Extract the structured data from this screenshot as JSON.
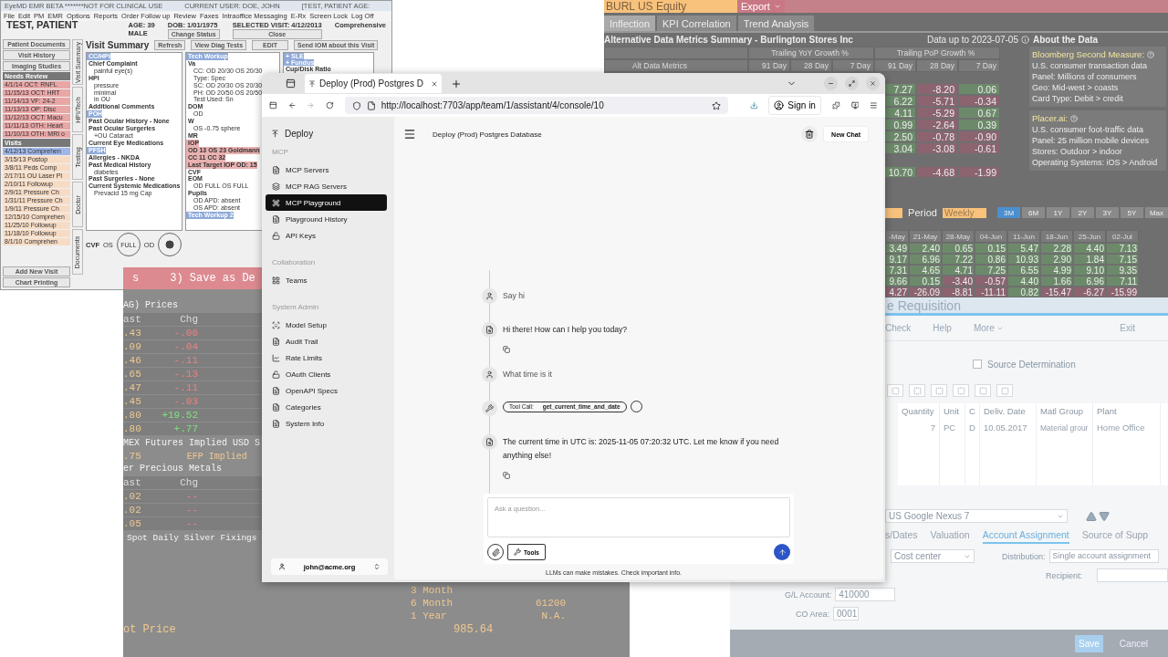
{
  "emr": {
    "title": "EyeMD EMR BETA *******NOT FOR CLINICAL USE",
    "user": "CURRENT USER: DOE, JOHN",
    "patient_tag": "[TEST, PATIENT AGE:",
    "menu": [
      "File",
      "Edit",
      "PM",
      "EMR",
      "Options",
      "Reports",
      "Order Follow up",
      "Review",
      "Faxes",
      "Intraoffice Messaging",
      "E-Rx",
      "Screen Lock",
      "Log Off"
    ],
    "patient": "TEST, PATIENT",
    "age": "AGE: 39",
    "sex": "MALE",
    "dob": "DOB: 1/01/1975",
    "visit": "SELECTED VISIT: 4/12/2013",
    "visit_type": "Comprehensive",
    "change_status": "Change Status",
    "close": "Close",
    "nav_buttons": [
      "Patient Documents",
      "Visit History",
      "Imaging Studies"
    ],
    "needs_review_title": "Needs Review",
    "needs_review": [
      "4/1/14 OCT: RNFL",
      "11/15/13 OCT: HRT",
      "11/14/13 VF: 24-2",
      "11/13/13 OP: Disc",
      "11/12/13 OCT: Macu",
      "11/11/13 OTH: Heart",
      "11/10/13 OTH: MRI o"
    ],
    "visits_title": "Visits",
    "visits": [
      {
        "text": "4/12/13 Comprehen",
        "selected": true
      },
      {
        "text": "3/15/13 Postop",
        "selected": false
      },
      {
        "text": "3/8/11 Peds Comp",
        "selected": false
      },
      {
        "text": "2/17/11 OU Laser PI",
        "selected": false
      },
      {
        "text": "2/10/11 Followup",
        "selected": false
      },
      {
        "text": "2/9/11 Pressure Ch",
        "selected": false
      },
      {
        "text": "1/31/11 Pressure Ch",
        "selected": false
      },
      {
        "text": "1/9/11 Pressure Ch",
        "selected": false
      },
      {
        "text": "12/15/10 Comprehen",
        "selected": false
      },
      {
        "text": "11/25/10 Followup",
        "selected": false
      },
      {
        "text": "11/18/10 Followup",
        "selected": false
      },
      {
        "text": "8/1/10 Comprehen",
        "selected": false
      }
    ],
    "side_tabs": [
      "Visit Summary",
      "HPI/Tech",
      "Testing",
      "Doctor",
      "Documents"
    ],
    "summary_title": "Visit Summary",
    "refresh": "Refresh",
    "view_diag": "View Diag Tests",
    "edit": "EDIT",
    "send_iom": "Send IOM about this Visit",
    "panels": [
      [
        {
          "text": "CC/HPI",
          "kind": "header"
        },
        {
          "text": "Chief Complaint",
          "kind": "bold"
        },
        {
          "text": "painful eye(s)",
          "kind": "plain"
        },
        {
          "text": "HPI",
          "kind": "bold"
        },
        {
          "text": "pressure",
          "kind": "plain"
        },
        {
          "text": "minimal",
          "kind": "plain"
        },
        {
          "text": "in OU",
          "kind": "plain"
        },
        {
          "text": "Additional Comments",
          "kind": "bold"
        },
        {
          "text": "POH",
          "kind": "header"
        },
        {
          "text": "Past Ocular History - None",
          "kind": "bold"
        },
        {
          "text": "Past Ocular Surgeries",
          "kind": "bold"
        },
        {
          "text": "+OU Cataract",
          "kind": "plain"
        },
        {
          "text": "Current Eye Medications",
          "kind": "bold"
        },
        {
          "text": "PFSH",
          "kind": "header"
        },
        {
          "text": "Allergies - NKDA",
          "kind": "bold"
        },
        {
          "text": "Past Medical History",
          "kind": "bold"
        },
        {
          "text": "diabetes",
          "kind": "plain"
        },
        {
          "text": "Past Surgeries - None",
          "kind": "bold"
        },
        {
          "text": "Current Systemic Medications",
          "kind": "bold"
        },
        {
          "text": "Prevacid 15 mg Cap",
          "kind": "plain"
        }
      ],
      [
        {
          "text": "Tech Workup",
          "kind": "header"
        },
        {
          "text": "Va",
          "kind": "bold"
        },
        {
          "text": "CC: OD 20/30 OS 20/30",
          "kind": "plain"
        },
        {
          "text": "Type: Spec",
          "kind": "plain"
        },
        {
          "text": "SC: OD 20/30 OS 20/30",
          "kind": "plain"
        },
        {
          "text": "PH: OD 20/50 OS 20/50",
          "kind": "plain"
        },
        {
          "text": "Test Used: Sn",
          "kind": "plain"
        },
        {
          "text": "DOM",
          "kind": "bold"
        },
        {
          "text": "OD",
          "kind": "plain"
        },
        {
          "text": "W",
          "kind": "bold"
        },
        {
          "text": "OS -0.75 sphere",
          "kind": "plain"
        },
        {
          "text": "MR",
          "kind": "bold"
        },
        {
          "text": "IOP",
          "kind": "alert"
        },
        {
          "text": "OD 13 OS 23 Goldmann",
          "kind": "alert"
        },
        {
          "text": "CC 11 CC 32",
          "kind": "alert"
        },
        {
          "text": "Last Target IOP OD: 15",
          "kind": "alert"
        },
        {
          "text": "CVF",
          "kind": "bold"
        },
        {
          "text": "EOM",
          "kind": "bold"
        },
        {
          "text": "OD FULL OS FULL",
          "kind": "plain"
        },
        {
          "text": "Pupils",
          "kind": "bold"
        },
        {
          "text": "OD APD: absent",
          "kind": "plain"
        },
        {
          "text": "OS APD: absent",
          "kind": "plain"
        },
        {
          "text": "Tech Workup 2",
          "kind": "header"
        }
      ],
      [
        {
          "text": "+ SLE",
          "kind": "header"
        },
        {
          "text": "+ Fundus",
          "kind": "header"
        },
        {
          "text": "Cup/Disk Ratio",
          "kind": "bold"
        }
      ]
    ],
    "cvf": "CVF",
    "os": "OS",
    "od": "OD",
    "full": "FULL",
    "add_visit": "Add New Visit",
    "chart_printing": "Chart Printing"
  },
  "bloomberg": {
    "ticker": "BURL US Equity",
    "export": "Export",
    "tabs": [
      {
        "label": "Inflection",
        "selected": true
      },
      {
        "label": "KPI Correlation",
        "selected": false
      },
      {
        "label": "Trend Analysis",
        "selected": false
      }
    ],
    "title": "Alternative Data Metrics Summary - Burlington Stores Inc",
    "data_up_to": "Data up to 2023-07-05",
    "about": "About the Data",
    "yoy_header": "Trailing YoY Growth %",
    "pop_header": "Trailing PoP Growth %",
    "metrics_header": "Alt Data Metrics",
    "yoy_days": [
      "91 Day",
      "28 Day",
      "7 Day"
    ],
    "pop_days": [
      "91 Day",
      "28 Day",
      "7 Day"
    ],
    "rows": [
      [
        {
          "value": "7.27",
          "negative": false
        },
        {
          "value": "-8.20",
          "negative": true
        },
        {
          "value": "0.06",
          "negative": false
        }
      ],
      [
        {
          "value": "6.22",
          "negative": false
        },
        {
          "value": "-5.71",
          "negative": true
        },
        {
          "value": "-0.34",
          "negative": true
        }
      ],
      [
        {
          "value": "4.11",
          "negative": false
        },
        {
          "value": "-5.29",
          "negative": true
        },
        {
          "value": "0.67",
          "negative": false
        }
      ],
      [
        {
          "value": "0.99",
          "negative": false
        },
        {
          "value": "-2.64",
          "negative": true
        },
        {
          "value": "0.39",
          "negative": false
        }
      ],
      [
        {
          "value": "2.50",
          "negative": false
        },
        {
          "value": "-0.78",
          "negative": true
        },
        {
          "value": "-0.90",
          "negative": true
        }
      ],
      [
        {
          "value": "3.04",
          "negative": false
        },
        {
          "value": "-3.08",
          "negative": true
        },
        {
          "value": "-0.61",
          "negative": true
        }
      ],
      [],
      [
        {
          "value": "10.70",
          "negative": false
        },
        {
          "value": "-4.68",
          "negative": true
        },
        {
          "value": "-1.99",
          "negative": true
        }
      ]
    ],
    "sources": [
      {
        "name": "Bloomberg Second Measure:",
        "lines": [
          "U.S. consumer transaction data",
          "Panel: Millions of consumers",
          "Geo: Mid-west > coasts",
          "Card Type: Debit > credit"
        ]
      },
      {
        "name": "Placer.ai:",
        "lines": [
          "U.S. consumer foot-traffic data",
          "Panel: 25 million mobile devices",
          "Stores: Outdoor > indoor",
          "Operating Systems: iOS > Android"
        ]
      }
    ],
    "period_label": "Period",
    "period": "Weekly",
    "ranges": [
      {
        "label": "3M",
        "selected": true
      },
      {
        "label": "6M",
        "selected": false
      },
      {
        "label": "1Y",
        "selected": false
      },
      {
        "label": "2Y",
        "selected": false
      },
      {
        "label": "3Y",
        "selected": false
      },
      {
        "label": "5Y",
        "selected": false
      },
      {
        "label": "Max",
        "selected": false
      }
    ],
    "weeks": [
      "-May",
      "21-May",
      "28-May",
      "04-Jun",
      "11-Jun",
      "18-Jun",
      "25-Jun",
      "02-Jul"
    ],
    "weekly_rows": [
      [
        {
          "value": "3.49",
          "negative": false
        },
        {
          "value": "2.40",
          "negative": false
        },
        {
          "value": "0.65",
          "negative": false
        },
        {
          "value": "0.15",
          "negative": false
        },
        {
          "value": "5.47",
          "negative": false
        },
        {
          "value": "2.28",
          "negative": false
        },
        {
          "value": "4.40",
          "negative": false
        },
        {
          "value": "7.13",
          "negative": false
        }
      ],
      [
        {
          "value": "9.17",
          "negative": false
        },
        {
          "value": "6.96",
          "negative": false
        },
        {
          "value": "7.22",
          "negative": false
        },
        {
          "value": "0.86",
          "negative": false
        },
        {
          "value": "10.93",
          "negative": false
        },
        {
          "value": "2.90",
          "negative": false
        },
        {
          "value": "1.84",
          "negative": false
        },
        {
          "value": "7.15",
          "negative": false
        }
      ],
      [
        {
          "value": "7.31",
          "negative": false
        },
        {
          "value": "4.65",
          "negative": false
        },
        {
          "value": "4.71",
          "negative": false
        },
        {
          "value": "7.25",
          "negative": false
        },
        {
          "value": "6.55",
          "negative": false
        },
        {
          "value": "4.99",
          "negative": false
        },
        {
          "value": "9.10",
          "negative": false
        },
        {
          "value": "9.35",
          "negative": false
        }
      ],
      [
        {
          "value": "9.66",
          "negative": false
        },
        {
          "value": "0.15",
          "negative": false
        },
        {
          "value": "-3.40",
          "negative": true
        },
        {
          "value": "-0.57",
          "negative": true
        },
        {
          "value": "4.40",
          "negative": false
        },
        {
          "value": "1.66",
          "negative": false
        },
        {
          "value": "6.96",
          "negative": false
        },
        {
          "value": "7.11",
          "negative": false
        }
      ],
      [
        {
          "value": "4.27",
          "negative": true
        },
        {
          "value": "-26.09",
          "negative": true
        },
        {
          "value": "-8.81",
          "negative": true
        },
        {
          "value": "-11.11",
          "negative": true
        },
        {
          "value": "0.82",
          "negative": false
        },
        {
          "value": "-15.47",
          "negative": true
        },
        {
          "value": "-6.27",
          "negative": true
        },
        {
          "value": "-15.99",
          "negative": true
        }
      ]
    ]
  },
  "sap": {
    "title": "e Requisition",
    "toolbar": [
      "Check",
      "Help",
      "More"
    ],
    "exit": "Exit",
    "source_determination": {
      "label": "Source Determination",
      "checked": false
    },
    "columns": [
      "Quantity",
      "Unit",
      "C",
      "Deliv. Date",
      "Matl Group",
      "Plant"
    ],
    "row": [
      "7",
      "PC",
      "D",
      "10.05.2017",
      "Material grour",
      "Home Office"
    ],
    "item": "US Google Nexus 7",
    "tabs": [
      {
        "label": "s/Dates",
        "selected": false
      },
      {
        "label": "Valuation",
        "selected": false
      },
      {
        "label": "Account Assignment",
        "selected": true
      },
      {
        "label": "Source of Supp",
        "selected": false
      }
    ],
    "category": "Cost center",
    "distribution_label": "Distribution:",
    "distribution": "Single account assignment",
    "recipient_label": "Recipient:",
    "gl_label": "G/L Account:",
    "gl": "410000",
    "co_label": "CO Area:",
    "co": "0001",
    "save": "Save",
    "cancel": "Cancel"
  },
  "metals": {
    "banner_left": "s",
    "banner": "3) Save as De",
    "prices_title": "AG) Prices",
    "headers": [
      "ast",
      "Chg"
    ],
    "prices": [
      {
        "last": ".43",
        "chg": "-.06"
      },
      {
        "last": ".09",
        "chg": "-.04"
      },
      {
        "last": ".46",
        "chg": "-.11"
      },
      {
        "last": ".65",
        "chg": "-.13"
      },
      {
        "last": ".47",
        "chg": "-.11"
      },
      {
        "last": ".45",
        "chg": "-.03"
      },
      {
        "last": ".80",
        "chg": "+19.52"
      },
      {
        "last": ".80",
        "chg": "+.77"
      }
    ],
    "futures": "MEX Futures Implied USD S",
    "efp_value": ".75",
    "efp": "EFP Implied",
    "precious": "er Precious Metals",
    "headers2": [
      "ast",
      "Chg"
    ],
    "precious_rows": [
      {
        "last": ".02",
        "chg": "--"
      },
      {
        "last": ".02",
        "chg": "--"
      },
      {
        "last": ".05",
        "chg": "--"
      }
    ],
    "fixings": "Spot Daily Silver Fixings",
    "terms": [
      {
        "label": "3 Month"
      },
      {
        "label": "6 Month",
        "value": "61200"
      },
      {
        "label": "1 Year",
        "value": "N.A."
      }
    ],
    "spot_label": "ot Price",
    "spot": "985.64"
  },
  "browser": {
    "tab_title": "Deploy (Prod) Postgres D",
    "url": "http://localhost:7703/app/team/1/assistant/4/console/10",
    "sign_in": "Sign in",
    "app": {
      "brand": "Deploy",
      "sections": [
        {
          "title": "MCP",
          "items": [
            {
              "label": "MCP Servers",
              "kind": "doc",
              "selected": false
            },
            {
              "label": "MCP RAG Servers",
              "kind": "layers",
              "selected": false
            },
            {
              "label": "MCP Playground",
              "kind": "command",
              "selected": true
            },
            {
              "label": "Playground History",
              "kind": "doc",
              "selected": false
            },
            {
              "label": "API Keys",
              "kind": "lock",
              "selected": false
            }
          ]
        },
        {
          "title": "Collaboration",
          "items": [
            {
              "label": "Teams",
              "kind": "grid",
              "selected": false
            }
          ]
        },
        {
          "title": "System Admin",
          "items": [
            {
              "label": "Model Setup",
              "kind": "scan",
              "selected": false
            },
            {
              "label": "Audit Trail",
              "kind": "doc",
              "selected": false
            },
            {
              "label": "Rate Limits",
              "kind": "chart",
              "selected": false
            },
            {
              "label": "OAuth Clients",
              "kind": "lock",
              "selected": false
            },
            {
              "label": "OpenAPI Specs",
              "kind": "doc",
              "selected": false
            },
            {
              "label": "Categories",
              "kind": "doc",
              "selected": false
            },
            {
              "label": "System Info",
              "kind": "doc",
              "selected": false
            }
          ]
        }
      ],
      "user": "john@acme.org",
      "chat_title": "Deploy (Prod) Postgres Database",
      "new_chat": "New Chat",
      "messages": [
        {
          "kind": "user",
          "text": "Say hi"
        },
        {
          "kind": "assistant",
          "text": "Hi there! How can I help you today?"
        },
        {
          "kind": "user",
          "text": "What time is it"
        },
        {
          "kind": "tool",
          "label": "Tool Call:",
          "text": "get_current_time_and_date"
        },
        {
          "kind": "assistant",
          "text": "The current time in UTC is: 2025-11-05 07:20:32 UTC. Let me know if you need anything else!"
        }
      ],
      "placeholder": "Ask a question...",
      "tools": "Tools",
      "disclaimer": "LLMs can make mistakes. Check important info."
    }
  }
}
